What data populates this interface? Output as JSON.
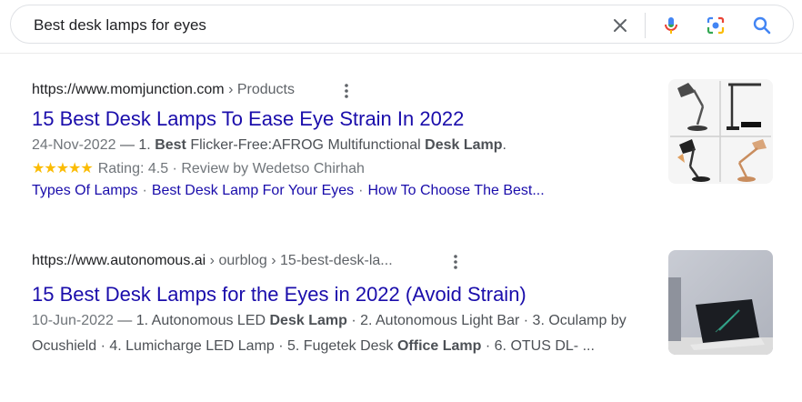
{
  "search": {
    "query": "Best desk lamps for eyes",
    "clear_icon": "close-icon",
    "mic_icon": "mic-icon",
    "lens_icon": "camera-lens-icon",
    "search_icon": "search-icon"
  },
  "results": [
    {
      "domain": "https://www.momjunction.com",
      "path": " › Products",
      "title": "15 Best Desk Lamps To Ease Eye Strain In 2022",
      "date": "24-Nov-2022",
      "snippet_parts": [
        {
          "text": " — 1. ",
          "bold": false
        },
        {
          "text": "Best",
          "bold": true
        },
        {
          "text": " Flicker-Free:AFROG Multifunctional ",
          "bold": false
        },
        {
          "text": "Desk Lamp",
          "bold": true
        },
        {
          "text": ".",
          "bold": false
        }
      ],
      "stars": "★★★★★",
      "rating_text": "Rating: 4.5 · Review by Wedetso Chirhah",
      "sitelinks": [
        "Types Of Lamps",
        "Best Desk Lamp For Your Eyes",
        "How To Choose The Best..."
      ]
    },
    {
      "domain": "https://www.autonomous.ai",
      "path": " › ourblog › 15-best-desk-la...",
      "title": "15 Best Desk Lamps for the Eyes in 2022 (Avoid Strain)",
      "date": "10-Jun-2022",
      "snippet_parts": [
        {
          "text": " — 1. Autonomous LED ",
          "bold": false
        },
        {
          "text": "Desk Lamp",
          "bold": true
        },
        {
          "text": " · 2. Autonomous Light Bar · 3. Oculamp by Ocushield · 4. Lumicharge LED Lamp · 5. Fugetek Desk ",
          "bold": false
        },
        {
          "text": "Office Lamp",
          "bold": true
        },
        {
          "text": " · 6. OTUS DL- ...",
          "bold": false
        }
      ]
    }
  ],
  "colors": {
    "link": "#1a0dab",
    "star": "#fbbc04",
    "snippet": "#4d5156",
    "muted": "#70757a"
  }
}
